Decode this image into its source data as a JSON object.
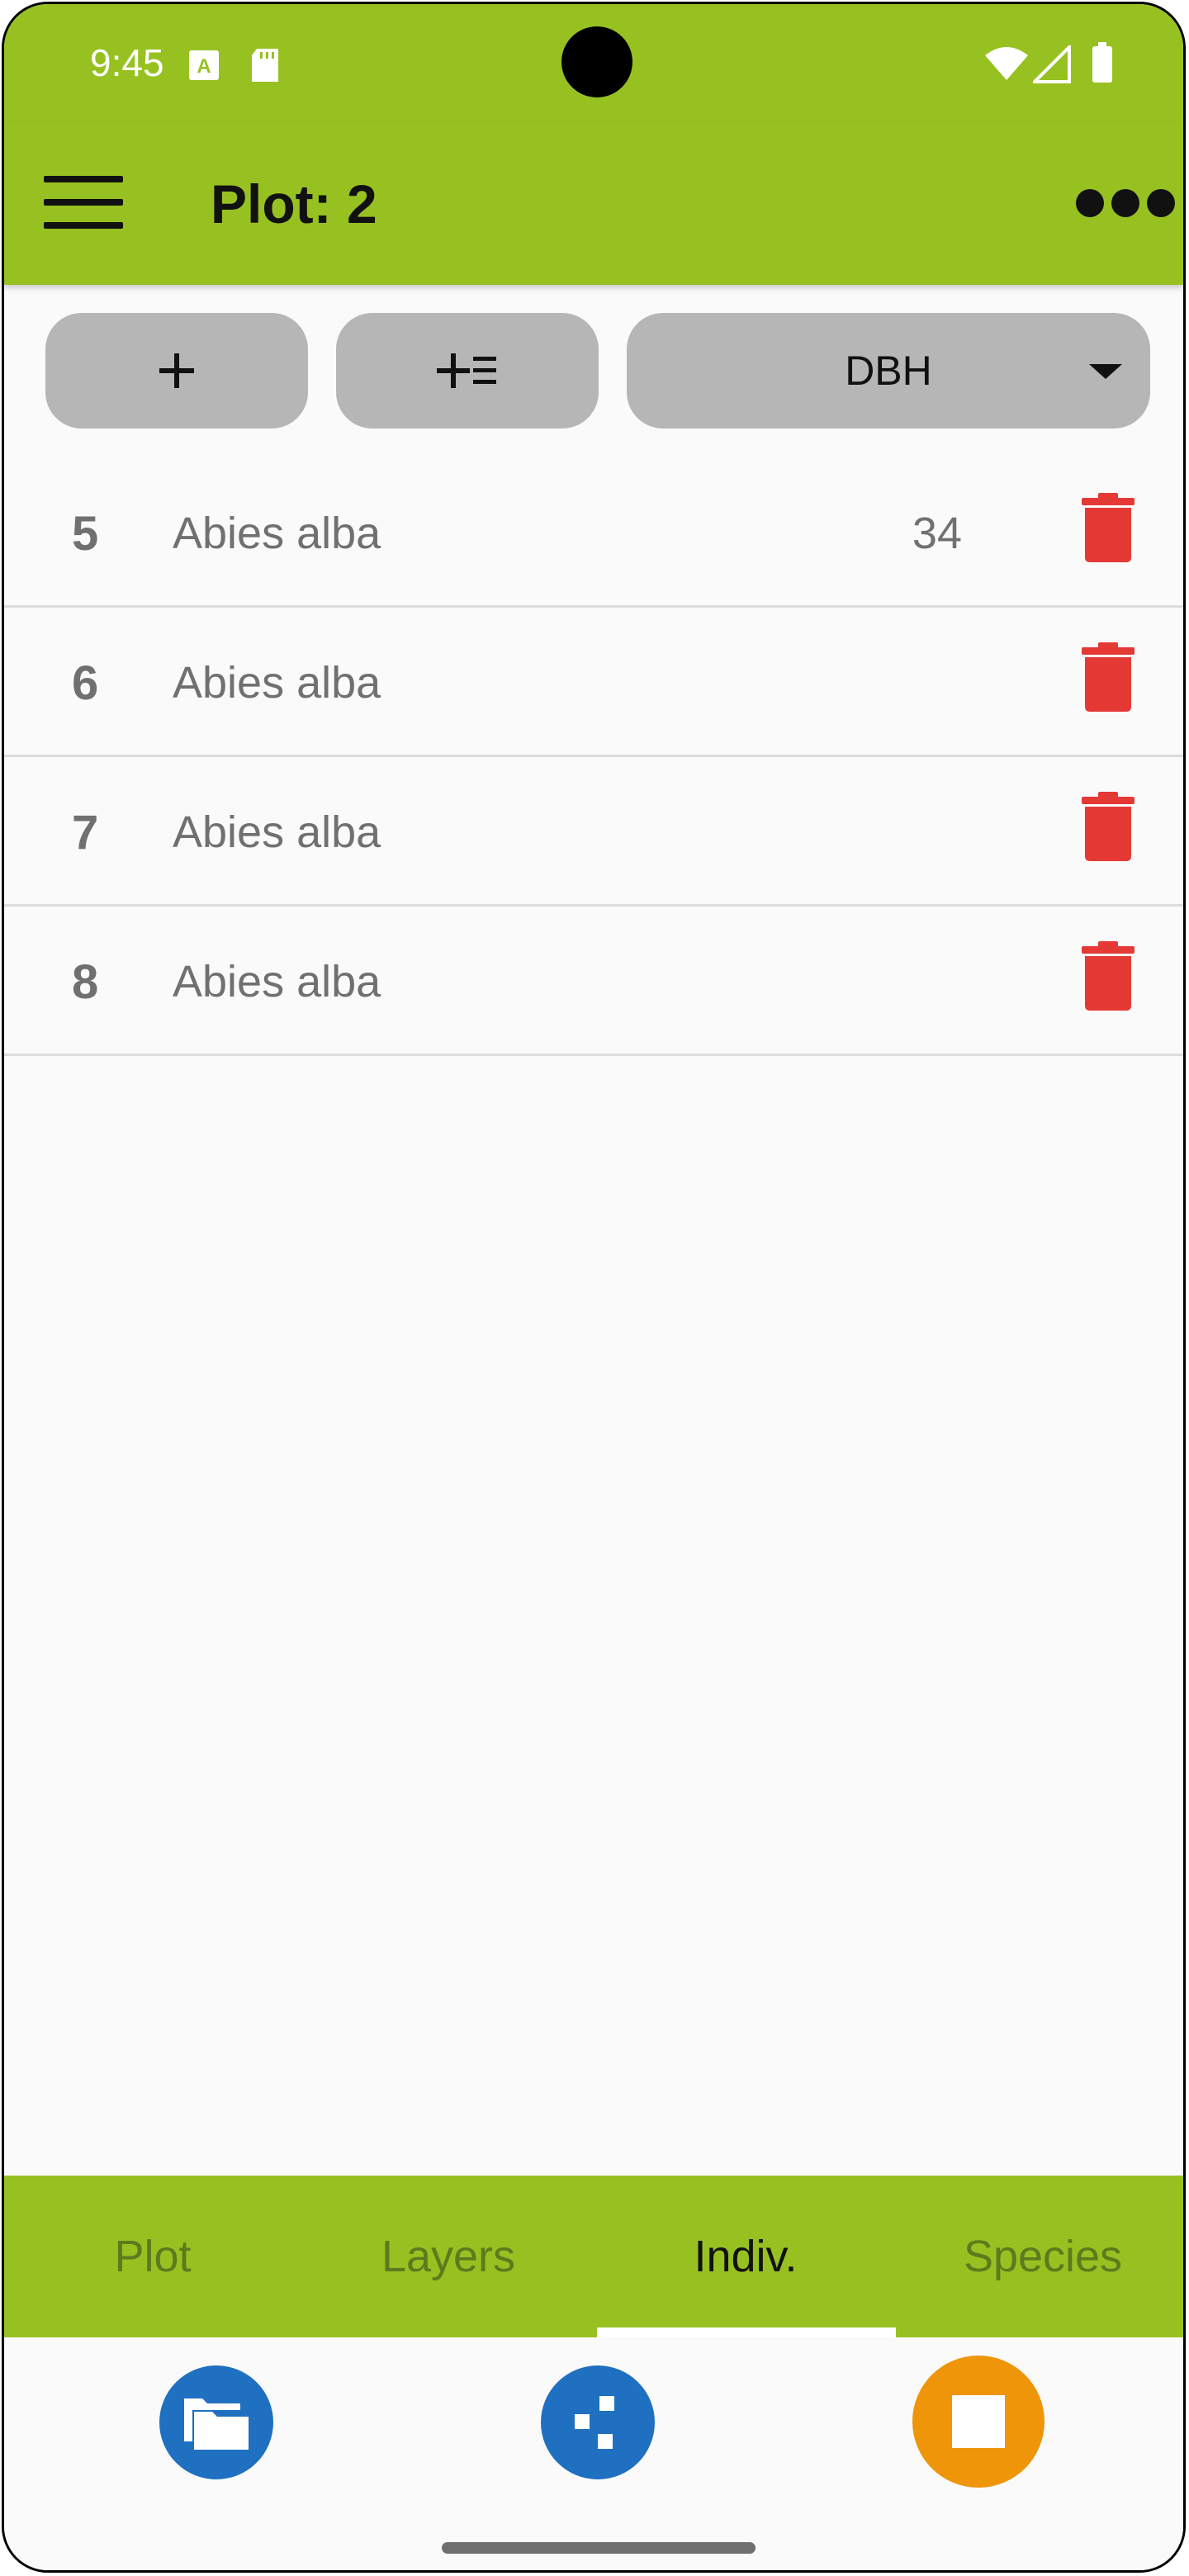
{
  "status_bar": {
    "time": "9:45",
    "icons": [
      "notification-a-icon",
      "sd-card-icon",
      "wifi-icon",
      "signal-icon",
      "battery-icon"
    ]
  },
  "app_bar": {
    "title": "Plot: 2",
    "menu_icon": "hamburger-menu-icon",
    "overflow_icon": "more-options-icon"
  },
  "toolbar": {
    "add_label": "+",
    "add_list_icon": "add-list-icon",
    "dropdown_selected": "DBH"
  },
  "individuals": [
    {
      "number": "5",
      "species": "Abies alba",
      "value": "34"
    },
    {
      "number": "6",
      "species": "Abies alba",
      "value": ""
    },
    {
      "number": "7",
      "species": "Abies alba",
      "value": ""
    },
    {
      "number": "8",
      "species": "Abies alba",
      "value": ""
    }
  ],
  "tabs": [
    {
      "label": "Plot",
      "active": false
    },
    {
      "label": "Layers",
      "active": false
    },
    {
      "label": "Indiv.",
      "active": true
    },
    {
      "label": "Species",
      "active": false
    }
  ],
  "bottom_actions": {
    "folder_icon": "folder-icon",
    "layout_icon": "scatter-layout-icon",
    "stop_icon": "stop-icon"
  },
  "colors": {
    "accent": "#97c121",
    "delete": "#e53935",
    "fab_blue": "#1f70c0",
    "fab_orange": "#ee9509",
    "button_grey": "#b6b6b6"
  }
}
